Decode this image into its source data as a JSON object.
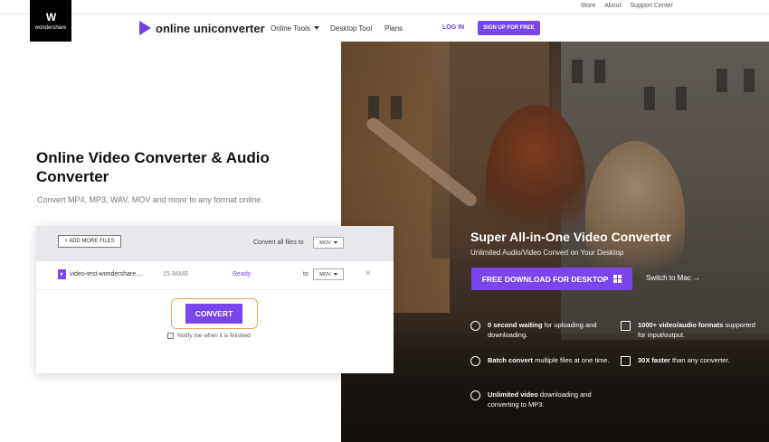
{
  "utility_links": [
    "Store",
    "About",
    "Support Center"
  ],
  "brand": {
    "name": "wondershare"
  },
  "nav": {
    "logo_text": "online uniconverter",
    "online_tools": "Online Tools",
    "desktop_tool": "Desktop Tool",
    "plans": "Plans",
    "login": "LOG IN",
    "signup": "SIGN UP FOR FREE"
  },
  "hero": {
    "title": "Online Video Converter & Audio Converter",
    "subtitle": "Convert MP4, MP3, WAV, MOV and more to any format online."
  },
  "converter": {
    "add_files": "+ ADD MORE FILES",
    "convert_all_label": "Convert all files to",
    "convert_all_format": "MOV",
    "file": {
      "name": "video-test-wondershare....",
      "size": "15.96MB",
      "status": "Ready",
      "to_label": "to",
      "format": "MOV",
      "remove": "×"
    },
    "convert_button": "CONVERT",
    "notify_label": "Notify me when it is finished"
  },
  "promo": {
    "title": "Super All-in-One Video Converter",
    "subtitle": "Unlimited Audio/Video Convert on Your Desktop",
    "download_button": "FREE DOWNLOAD FOR DESKTOP",
    "switch_mac": "Switch to Mac →",
    "features": [
      {
        "bold": "0 second waiting",
        "rest": " for uploading and downloading."
      },
      {
        "bold": "1000+ video/audio formats",
        "rest": " supported for input/output."
      },
      {
        "bold": "Batch convert",
        "rest": " multiple files at one time."
      },
      {
        "bold": "30X faster",
        "rest": " than any converter."
      },
      {
        "bold": "Unlimited video",
        "rest": " downloading and converting to MP3."
      }
    ]
  },
  "colors": {
    "accent": "#7a45ea",
    "highlight": "#f5a25a"
  }
}
